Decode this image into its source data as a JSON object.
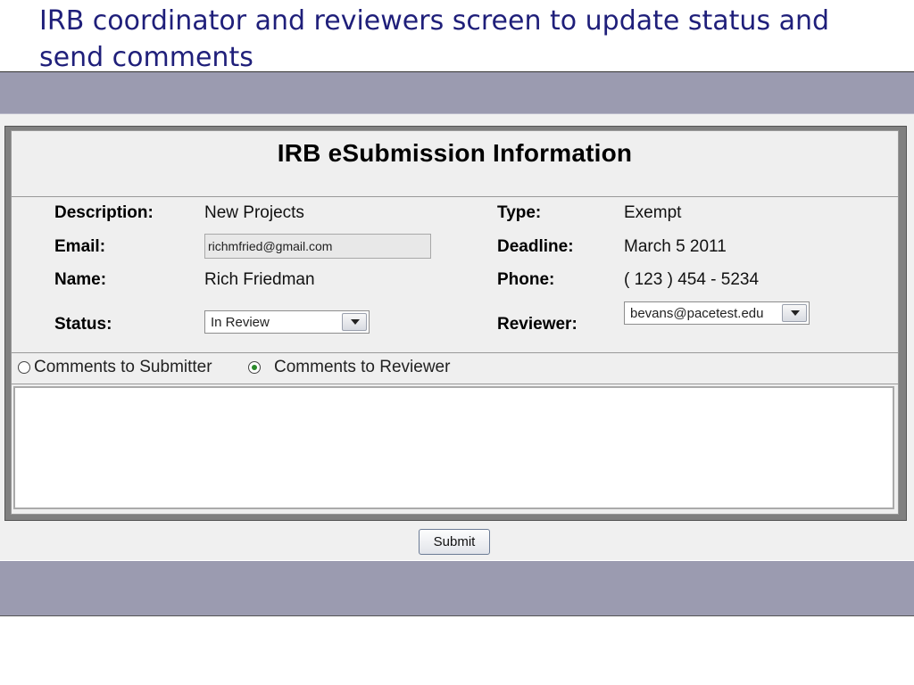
{
  "slide": {
    "title": "IRB coordinator and reviewers screen to update status and send comments"
  },
  "panel": {
    "title": "IRB eSubmission Information"
  },
  "fields": {
    "description": {
      "label": "Description:",
      "value": "New Projects"
    },
    "email": {
      "label": "Email:",
      "value": "richmfried@gmail.com"
    },
    "name": {
      "label": "Name:",
      "value": "Rich Friedman"
    },
    "status": {
      "label": "Status:",
      "selected": "In Review"
    },
    "type": {
      "label": "Type:",
      "value": "Exempt"
    },
    "deadline": {
      "label": "Deadline:",
      "value": "March 5 2011"
    },
    "phone": {
      "label": "Phone:",
      "value": "( 123 ) 454 - 5234"
    },
    "reviewer": {
      "label": "Reviewer:",
      "selected": "bevans@pacetest.edu"
    }
  },
  "comments": {
    "options": [
      {
        "label": "Comments to Submitter",
        "checked": false
      },
      {
        "label": "Comments to Reviewer",
        "checked": true
      }
    ],
    "text": ""
  },
  "actions": {
    "submit_label": "Submit"
  },
  "colors": {
    "band": "#9b9bb0",
    "title_text": "#1f1f7a",
    "panel_border": "#808080",
    "radio_dot": "#2a8a2a"
  }
}
